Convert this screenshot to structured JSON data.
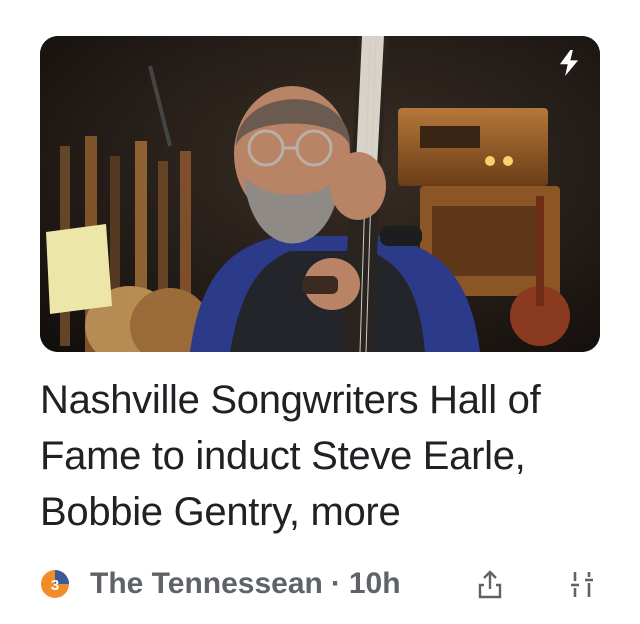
{
  "article": {
    "headline": "Nashville Songwriters Hall of Fame to induct Steve Earle, Bobbie Gentry, more",
    "publisher": "The Tennessean",
    "separator": "·",
    "age": "10h",
    "image_subject": "man with glasses and grey beard holding a guitar in front of amplifiers and guitar rack"
  },
  "icons": {
    "amp_badge": "lightning-bolt-icon",
    "publisher_logo": "tennessean-logo-icon",
    "share": "share-icon",
    "more": "tune-icon"
  },
  "colors": {
    "headline": "#202124",
    "meta": "#5f6368",
    "logo_orange": "#f28c28",
    "logo_blue": "#3a5a9a"
  }
}
